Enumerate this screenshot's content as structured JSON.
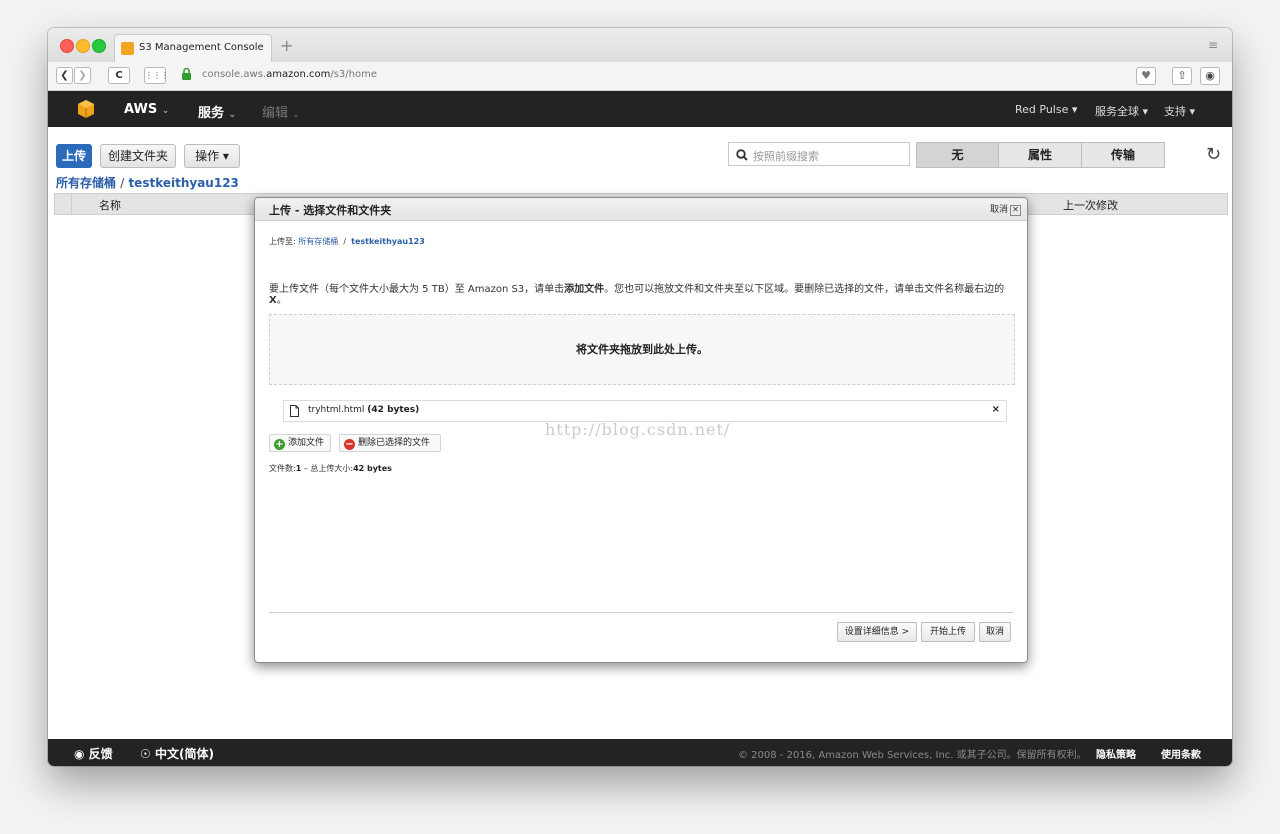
{
  "browser": {
    "tab_title": "S3 Management Console",
    "new_tab_glyph": "+",
    "url_prefix": "console.aws.",
    "url_domain": "amazon.com",
    "url_path": "/s3/home"
  },
  "awsnav": {
    "brand": "AWS",
    "services": "服务",
    "edit": "编辑",
    "account": "Red Pulse",
    "region": "服务全球",
    "support": "支持"
  },
  "toolbar": {
    "upload": "上传",
    "create_folder": "创建文件夹",
    "actions": "操作",
    "search_placeholder": "按照前缀搜索",
    "seg_none": "无",
    "seg_properties": "属性",
    "seg_transfers": "传输"
  },
  "breadcrumb": {
    "all_buckets": "所有存储桶",
    "separator": "/",
    "bucket": "testkeithyau123"
  },
  "table": {
    "col_name": "名称",
    "col_modified": "上一次修改"
  },
  "modal": {
    "title": "上传 - 选择文件和文件夹",
    "cancel_top": "取消",
    "upload_to_label": "上传至:",
    "upload_to_root": "所有存储桶",
    "upload_to_sep": "/",
    "upload_to_bucket": "testkeithyau123",
    "instructions_a": "要上传文件（每个文件大小最大为 5 TB）至 Amazon S3，请单击",
    "instructions_add": "添加文件",
    "instructions_b": "。您也可以拖放文件和文件夹至以下区域。要删除已选择的文件，请单击文件名称最右边的",
    "instructions_x": "X",
    "instructions_c": "。",
    "dropzone_text": "将文件夹拖放到此处上传。",
    "file_name": "tryhtml.html",
    "file_size": "(42 bytes)",
    "file_remove": "×",
    "add_files": "添加文件",
    "remove_selected": "删除已选择的文件",
    "count_label": "文件数:",
    "count_value": "1",
    "total_label": " – 总上传大小:",
    "total_value": "42 bytes",
    "set_details": "设置详细信息 >",
    "start_upload": "开始上传",
    "cancel_bottom": "取消"
  },
  "watermark": "http://blog.csdn.net/",
  "footer": {
    "feedback": "反馈",
    "language": "中文(简体)",
    "copyright": "© 2008 - 2016, Amazon Web Services, Inc. 或其子公司。保留所有权利。",
    "privacy": "隐私策略",
    "terms": "使用条款"
  },
  "colors": {
    "aws_nav": "#232323",
    "primary_button": "#2b6bba",
    "link": "#2b5fa8",
    "add_icon": "#3a9b2e",
    "remove_icon": "#d9342b"
  }
}
